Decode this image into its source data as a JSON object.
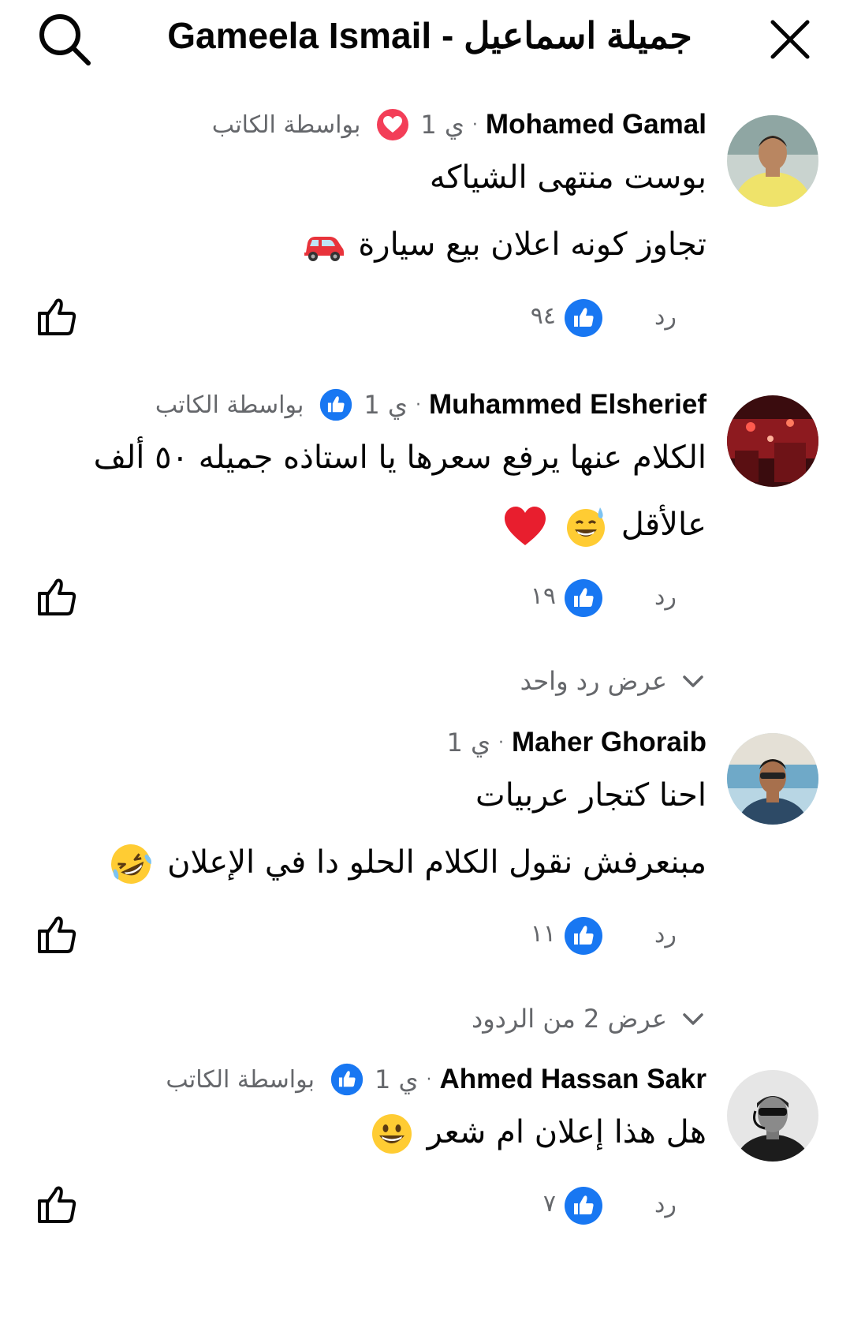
{
  "header": {
    "title": "Gameela Ismail - جميلة اسماعيل",
    "search_icon": "search-icon",
    "close_icon": "close-icon"
  },
  "comments": [
    {
      "author": "Mohamed Gamal",
      "time": "1 ي",
      "author_reaction": "heart",
      "author_label": "بواسطة الكاتب",
      "lines": [
        "بوست منتهى الشياكه",
        "تجاوز كونه اعلان بيع سيارة"
      ],
      "line_emojis": [
        [],
        [
          "car-emoji"
        ]
      ],
      "like_count": "٩٤",
      "reply_label": "رد"
    },
    {
      "author": "Muhammed Elsherief",
      "time": "1 ي",
      "author_reaction": "like",
      "author_label": "بواسطة الكاتب",
      "lines": [
        "الكلام عنها يرفع سعرها يا استاذه جميله ٥٠ ألف",
        "عالأقل"
      ],
      "line_emojis": [
        [],
        [
          "sweat-smile-emoji",
          "red-heart-emoji"
        ]
      ],
      "like_count": "١٩",
      "reply_label": "رد",
      "view_replies": "عرض رد واحد"
    },
    {
      "author": "Maher Ghoraib",
      "time": "1 ي",
      "lines": [
        "احنا كتجار عربيات",
        "مبنعرفش  نقول الكلام الحلو دا في الإعلان"
      ],
      "line_emojis": [
        [],
        [
          "rofl-emoji"
        ]
      ],
      "like_count": "١١",
      "reply_label": "رد",
      "view_replies": "عرض 2 من الردود"
    },
    {
      "author": "Ahmed Hassan Sakr",
      "time": "1 ي",
      "author_reaction": "like",
      "author_label": "بواسطة الكاتب",
      "lines": [
        "هل هذا إعلان ام شعر"
      ],
      "line_emojis": [
        [
          "grinning-emoji"
        ]
      ],
      "like_count": "٧",
      "reply_label": "رد"
    }
  ],
  "colors": {
    "text": "#050505",
    "secondary_text": "#65676b",
    "like_blue": "#1877f2",
    "love_red": "#f33e58"
  }
}
